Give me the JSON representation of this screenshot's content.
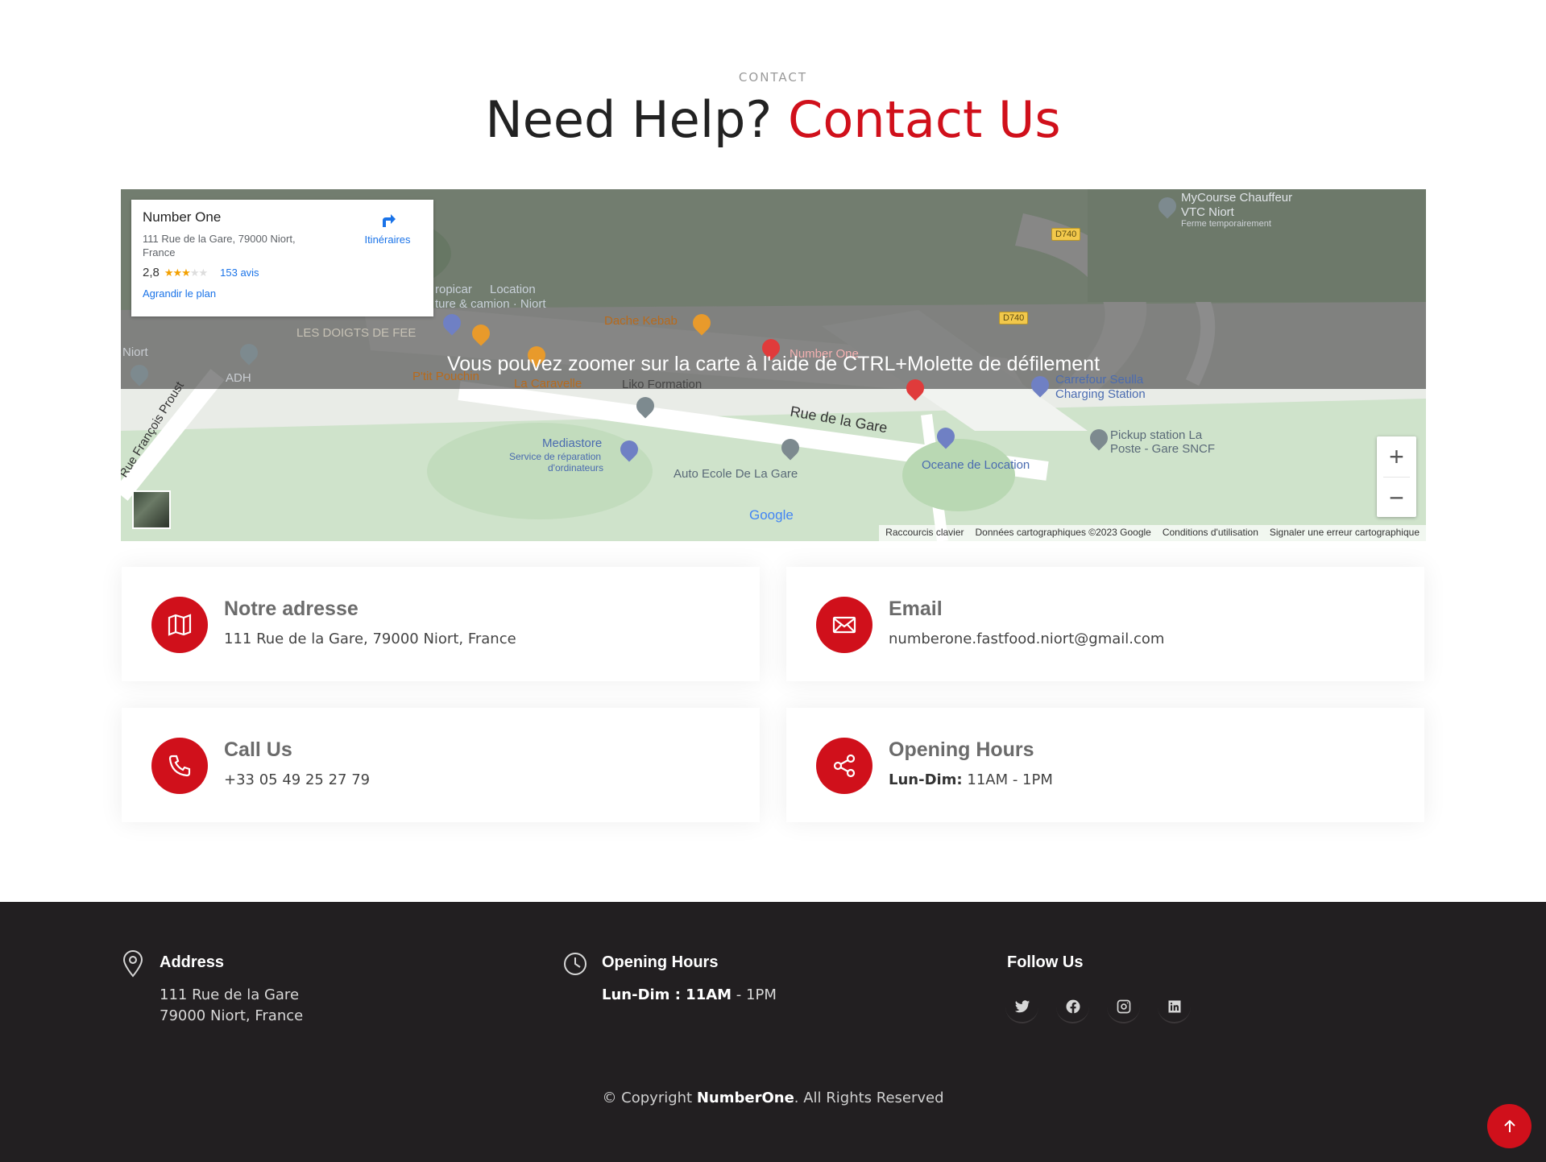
{
  "section": {
    "eyebrow": "CONTACT",
    "title_part1": "Need Help?",
    "title_part2": "Contact Us",
    "accent_color": "#d0101b"
  },
  "map": {
    "zoom_hint": "Vous pouvez zoomer sur la carte à l'aide de CTRL+Molette de défilement",
    "card": {
      "place_name": "Number One",
      "address": "111 Rue de la Gare, 79000 Niort, France",
      "rating": "2,8",
      "stars_filled": 3,
      "reviews": "153 avis",
      "enlarge": "Agrandir le plan",
      "directions": "Itinéraires"
    },
    "labels": {
      "mycourse": "MyCourse Chauffeur",
      "vtc": "VTC Niort",
      "vtc_status": "Ferme temporairement",
      "d740a": "D740",
      "d740b": "D740",
      "location": "Location",
      "camion": "ture & camion · Niort",
      "tropicar": "ropicar",
      "doigts": "LES DOIGTS DE FEE",
      "dache": "Dache Kebab",
      "niort_left": "Niort",
      "adh": "ADH",
      "number_one_pin": "Number One",
      "ptit": "P'tit Pouchin",
      "carambole": "La Caravelle",
      "liko": "Liko Formation",
      "carrefour": "Carrefour Seulla",
      "charging": "Charging Station",
      "rue_gare": "Rue de la Gare",
      "proust": "Rue François Proust",
      "mediastore": "Mediastore",
      "mediastore_sub1": "Service de réparation",
      "mediastore_sub2": "d'ordinateurs",
      "oceane": "Oceane de Location",
      "auto_ecole": "Auto Ecole De La Gare",
      "pickup1": "Pickup station La",
      "pickup2": "Poste - Gare SNCF",
      "google": "Google"
    },
    "zoom_in": "+",
    "zoom_out": "−",
    "footer": {
      "shortcuts": "Raccourcis clavier",
      "data": "Données cartographiques ©2023 Google",
      "terms": "Conditions d'utilisation",
      "report": "Signaler une erreur cartographique"
    }
  },
  "cards": {
    "address": {
      "title": "Notre adresse",
      "text": "111 Rue de la Gare, 79000 Niort, France",
      "icon": "map-icon"
    },
    "email": {
      "title": "Email",
      "text": "numberone.fastfood.niort@gmail.com",
      "icon": "envelope-icon"
    },
    "call": {
      "title": "Call Us",
      "text": "+33 05 49 25 27 79",
      "icon": "phone-icon"
    },
    "hours": {
      "title": "Opening Hours",
      "label": "Lun-Dim:",
      "text": "11AM - 1PM",
      "icon": "share-icon"
    }
  },
  "footer": {
    "address": {
      "title": "Address",
      "line1": "111 Rue de la Gare",
      "line2": "79000 Niort, France"
    },
    "hours": {
      "title": "Opening Hours",
      "label": "Lun-Dim : 11AM",
      "text": "- 1PM"
    },
    "follow": {
      "title": "Follow Us",
      "icons": [
        "twitter-icon",
        "facebook-icon",
        "instagram-icon",
        "linkedin-icon"
      ]
    },
    "copyright_pre": "© Copyright",
    "copyright_brand": "NumberOne",
    "copyright_post": ". All Rights Reserved",
    "background": "#221f21"
  }
}
